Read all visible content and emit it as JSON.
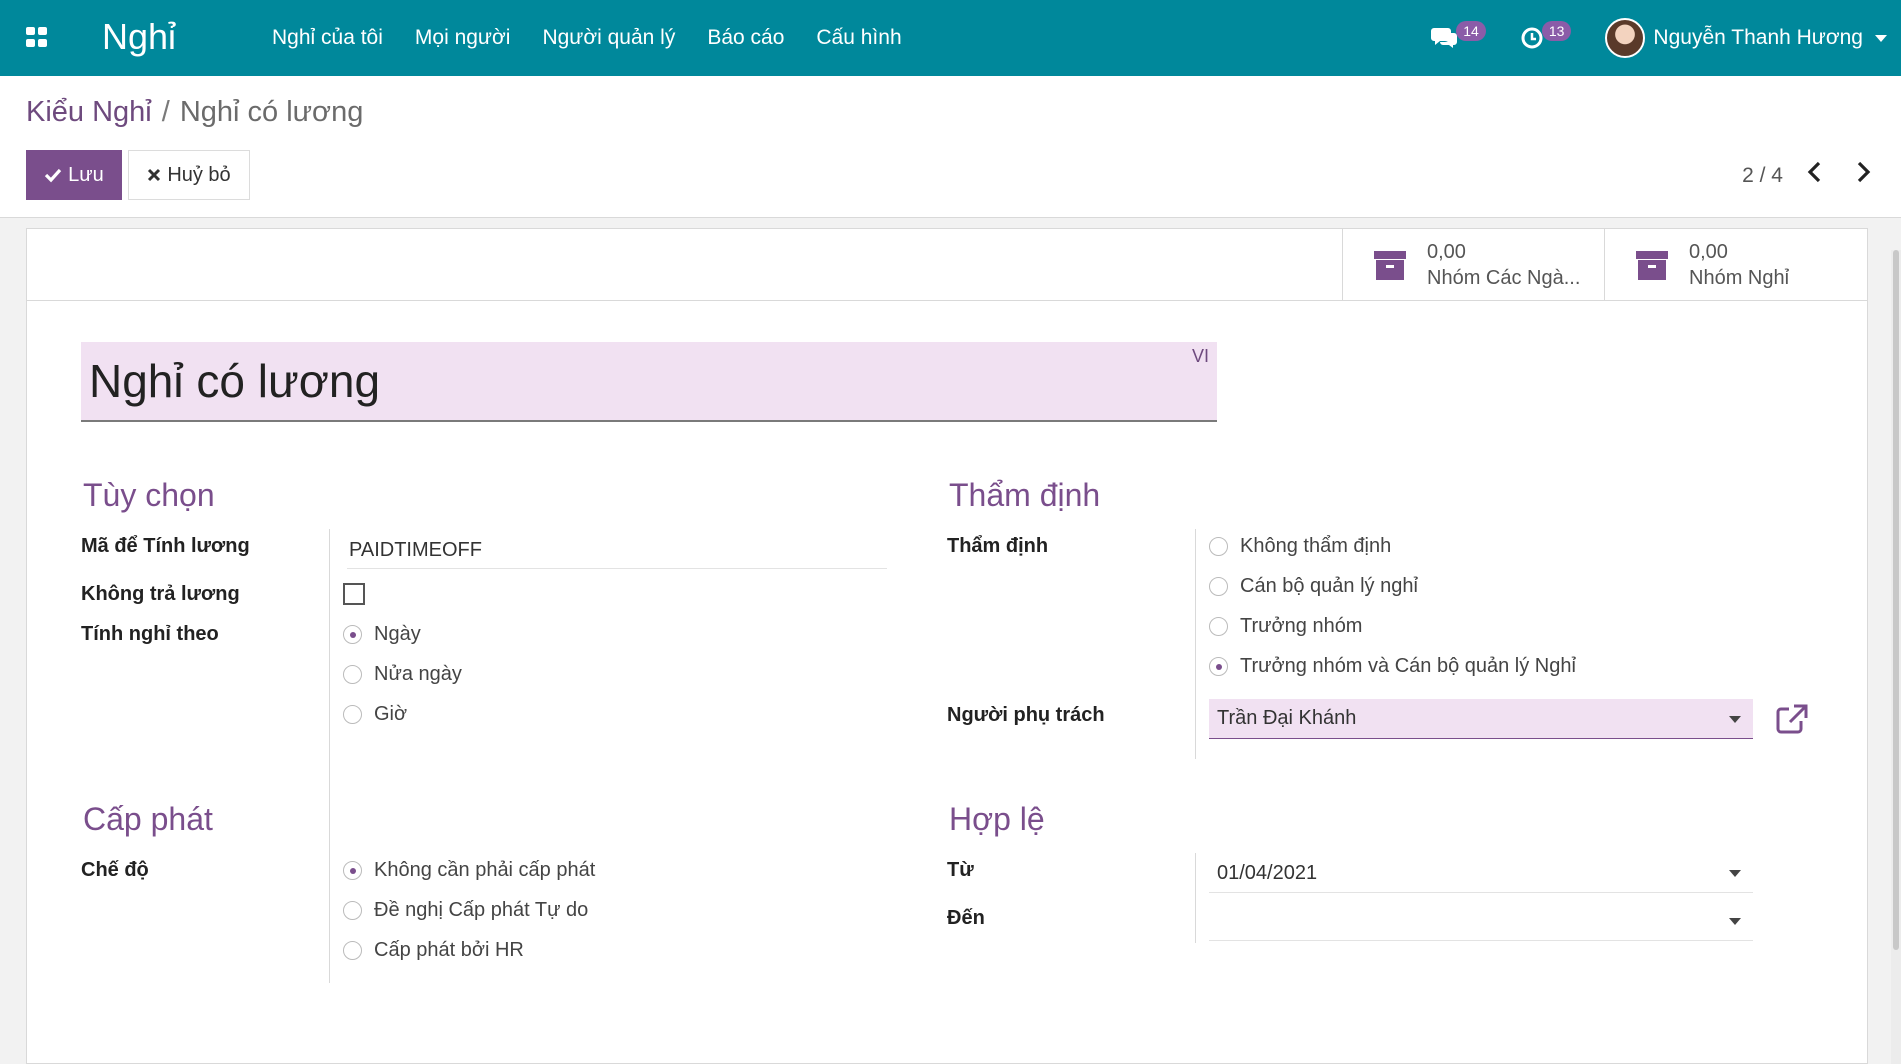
{
  "navbar": {
    "brand": "Nghỉ",
    "menu": [
      "Nghỉ của tôi",
      "Mọi người",
      "Người quản lý",
      "Báo cáo",
      "Cấu hình"
    ],
    "messages_count": "14",
    "activities_count": "13",
    "user_name": "Nguyễn Thanh Hương"
  },
  "breadcrumb": {
    "parent": "Kiểu Nghỉ",
    "separator": "/",
    "current": "Nghỉ có lương"
  },
  "buttons": {
    "save": "Lưu",
    "discard": "Huỷ bỏ"
  },
  "pager": {
    "value": "2 / 4"
  },
  "stat_buttons": [
    {
      "value": "0,00",
      "label": "Nhóm Các Ngà..."
    },
    {
      "value": "0,00",
      "label": "Nhóm Nghỉ"
    }
  ],
  "record": {
    "name": "Nghỉ có lương",
    "lang": "VI"
  },
  "options": {
    "title": "Tùy chọn",
    "payroll_code_label": "Mã để Tính lương",
    "payroll_code_value": "PAIDTIMEOFF",
    "unpaid_label": "Không trả lương",
    "unpaid_checked": false,
    "take_in_label": "Tính nghỉ theo",
    "take_in_options": [
      "Ngày",
      "Nửa ngày",
      "Giờ"
    ],
    "take_in_selected": 0
  },
  "validation": {
    "title": "Thẩm định",
    "validation_label": "Thẩm định",
    "validation_options": [
      "Không thẩm định",
      "Cán bộ quản lý nghỉ",
      "Trưởng nhóm",
      "Trưởng nhóm và Cán bộ quản lý Nghỉ"
    ],
    "validation_selected": 3,
    "responsible_label": "Người phụ trách",
    "responsible_value": "Trần Đại Khánh"
  },
  "allocation": {
    "title": "Cấp phát",
    "mode_label": "Chế độ",
    "mode_options": [
      "Không cần phải cấp phát",
      "Đề nghị Cấp phát Tự do",
      "Cấp phát bởi HR"
    ],
    "mode_selected": 0
  },
  "validity": {
    "title": "Hợp lệ",
    "from_label": "Từ",
    "from_value": "01/04/2021",
    "to_label": "Đến",
    "to_value": ""
  },
  "colors": {
    "navbar": "#00889b",
    "primary": "#7a4e8c",
    "required_field": "#f1e1f2"
  }
}
